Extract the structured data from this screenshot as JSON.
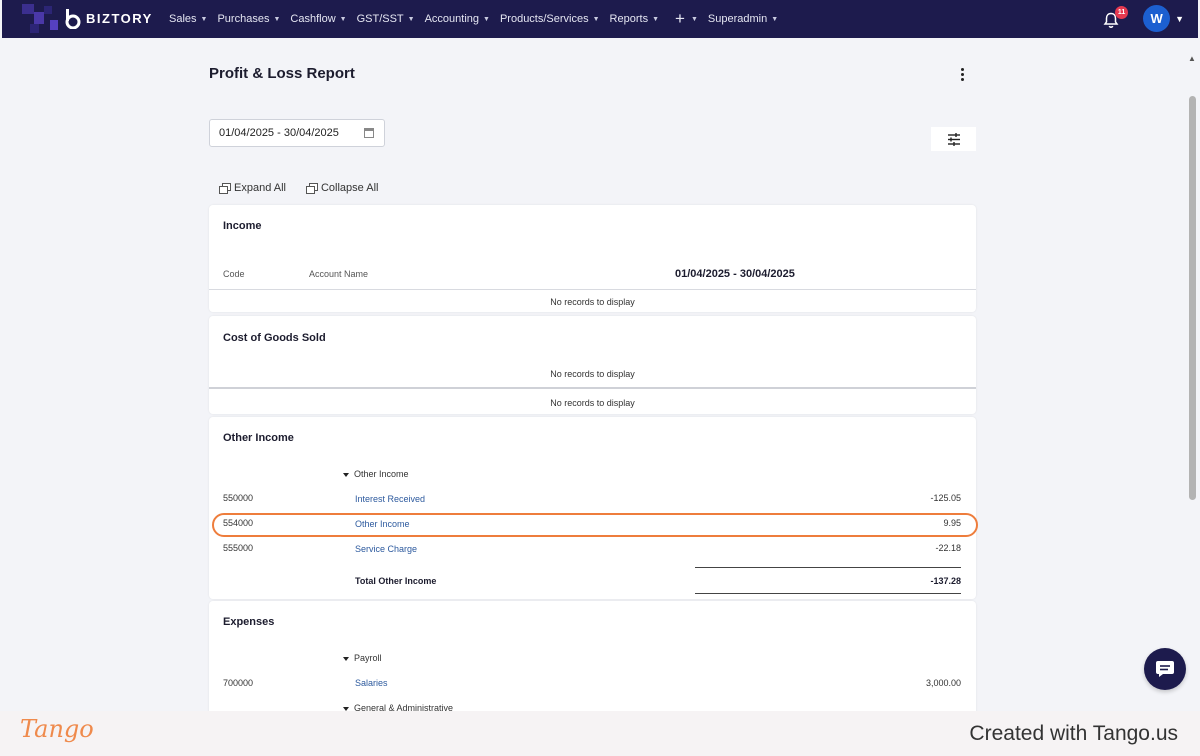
{
  "nav": {
    "brand": "BIZTORY",
    "items": [
      "Sales",
      "Purchases",
      "Cashflow",
      "GST/SST",
      "Accounting",
      "Products/Services",
      "Reports"
    ],
    "plus": "+",
    "superadmin": "Superadmin",
    "notification_count": "11",
    "avatar_initial": "W"
  },
  "page": {
    "title": "Profit & Loss Report",
    "date_range": "01/04/2025 - 30/04/2025",
    "expand_all": "Expand All",
    "collapse_all": "Collapse All"
  },
  "income": {
    "title": "Income",
    "col_code": "Code",
    "col_name": "Account Name",
    "col_period": "01/04/2025 - 30/04/2025",
    "empty": "No records to display"
  },
  "cogs": {
    "title": "Cost of Goods Sold",
    "empty1": "No records to display",
    "empty2": "No records to display"
  },
  "other_income": {
    "title": "Other Income",
    "group": "Other Income",
    "rows": [
      {
        "code": "550000",
        "name": "Interest Received",
        "amount": "-125.05"
      },
      {
        "code": "554000",
        "name": "Other Income",
        "amount": "9.95"
      },
      {
        "code": "555000",
        "name": "Service Charge",
        "amount": "-22.18"
      }
    ],
    "total_label": "Total Other Income",
    "total_amount": "-137.28"
  },
  "expenses": {
    "title": "Expenses",
    "group1": "Payroll",
    "rows": [
      {
        "code": "700000",
        "name": "Salaries",
        "amount": "3,000.00"
      }
    ],
    "group2": "General & Administrative"
  },
  "footer": {
    "logo": "Tango",
    "created": "Created with Tango.us"
  },
  "colors": {
    "nav_bg": "#1d1b4d",
    "link": "#2d5a9e",
    "highlight": "#ee7d3c",
    "badge": "#e53950",
    "avatar": "#1c5fd0"
  }
}
